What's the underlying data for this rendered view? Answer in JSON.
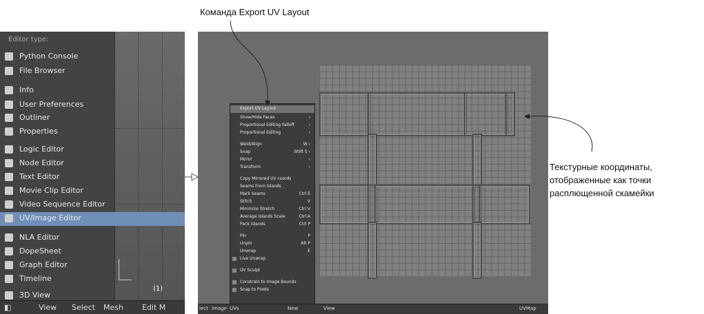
{
  "annotations": {
    "top_caption": "Команда Export UV Layout",
    "right_caption_lines": [
      "Текстурные координаты,",
      "отображенные как точки",
      "расплющенной скамейки"
    ]
  },
  "left_panel": {
    "menu_header": "Editor type:",
    "items": [
      {
        "label": "Python Console",
        "icon": "python-console-icon"
      },
      {
        "label": "File Browser",
        "icon": "folder-icon"
      },
      {
        "label": "Info",
        "icon": "info-icon"
      },
      {
        "label": "User Preferences",
        "icon": "preferences-icon"
      },
      {
        "label": "Outliner",
        "icon": "outliner-icon"
      },
      {
        "label": "Properties",
        "icon": "properties-icon"
      },
      {
        "label": "Logic Editor",
        "icon": "logic-icon"
      },
      {
        "label": "Node Editor",
        "icon": "node-icon"
      },
      {
        "label": "Text Editor",
        "icon": "text-icon"
      },
      {
        "label": "Movie Clip Editor",
        "icon": "movie-clip-icon"
      },
      {
        "label": "Video Sequence Editor",
        "icon": "sequence-icon"
      },
      {
        "label": "UV/Image Editor",
        "icon": "image-icon"
      },
      {
        "label": "NLA Editor",
        "icon": "nla-icon"
      },
      {
        "label": "DopeSheet",
        "icon": "dopesheet-icon"
      },
      {
        "label": "Graph Editor",
        "icon": "graph-icon"
      },
      {
        "label": "Timeline",
        "icon": "timeline-icon"
      },
      {
        "label": "3D View",
        "icon": "3d-view-icon"
      }
    ],
    "frame_indicator": "(1)",
    "bottombar": {
      "view": "View",
      "select": "Select",
      "mesh": "Mesh",
      "mode": "Edit M"
    }
  },
  "uv_menu": {
    "items": [
      {
        "label": "Export UV Layout",
        "shortcut": ""
      },
      {
        "label": "Show/Hide Faces",
        "shortcut": "›"
      },
      {
        "label": "Proportional Editing Falloff",
        "shortcut": "›"
      },
      {
        "label": "Proportional Editing",
        "shortcut": "›"
      },
      {
        "label": "Weld/Align",
        "shortcut": "W ›"
      },
      {
        "label": "Snap",
        "shortcut": "Shift S ›"
      },
      {
        "label": "Mirror",
        "shortcut": "›"
      },
      {
        "label": "Transform",
        "shortcut": "›"
      },
      {
        "label": "Copy Mirrored UV coords",
        "shortcut": ""
      },
      {
        "label": "Seams From Islands",
        "shortcut": ""
      },
      {
        "label": "Mark Seams",
        "shortcut": "Ctrl E"
      },
      {
        "label": "Stitch",
        "shortcut": "V"
      },
      {
        "label": "Minimize Stretch",
        "shortcut": "Ctrl V"
      },
      {
        "label": "Average Islands Scale",
        "shortcut": "Ctrl A"
      },
      {
        "label": "Pack Islands",
        "shortcut": "Ctrl P"
      },
      {
        "label": "Pin",
        "shortcut": "P"
      },
      {
        "label": "Unpin",
        "shortcut": "Alt P"
      },
      {
        "label": "Unwrap",
        "shortcut": "E"
      },
      {
        "label": "Live Unwrap",
        "shortcut": ""
      },
      {
        "label": "UV Sculpt",
        "shortcut": ""
      },
      {
        "label": "Constrain to Image Bounds",
        "shortcut": ""
      },
      {
        "label": "Snap to Pixels",
        "shortcut": ""
      }
    ]
  },
  "right_bottombar": {
    "select": "lect",
    "image": "Image",
    "uvs": "UVs",
    "new": "New",
    "view": "View",
    "uvmap": "UVMap"
  }
}
